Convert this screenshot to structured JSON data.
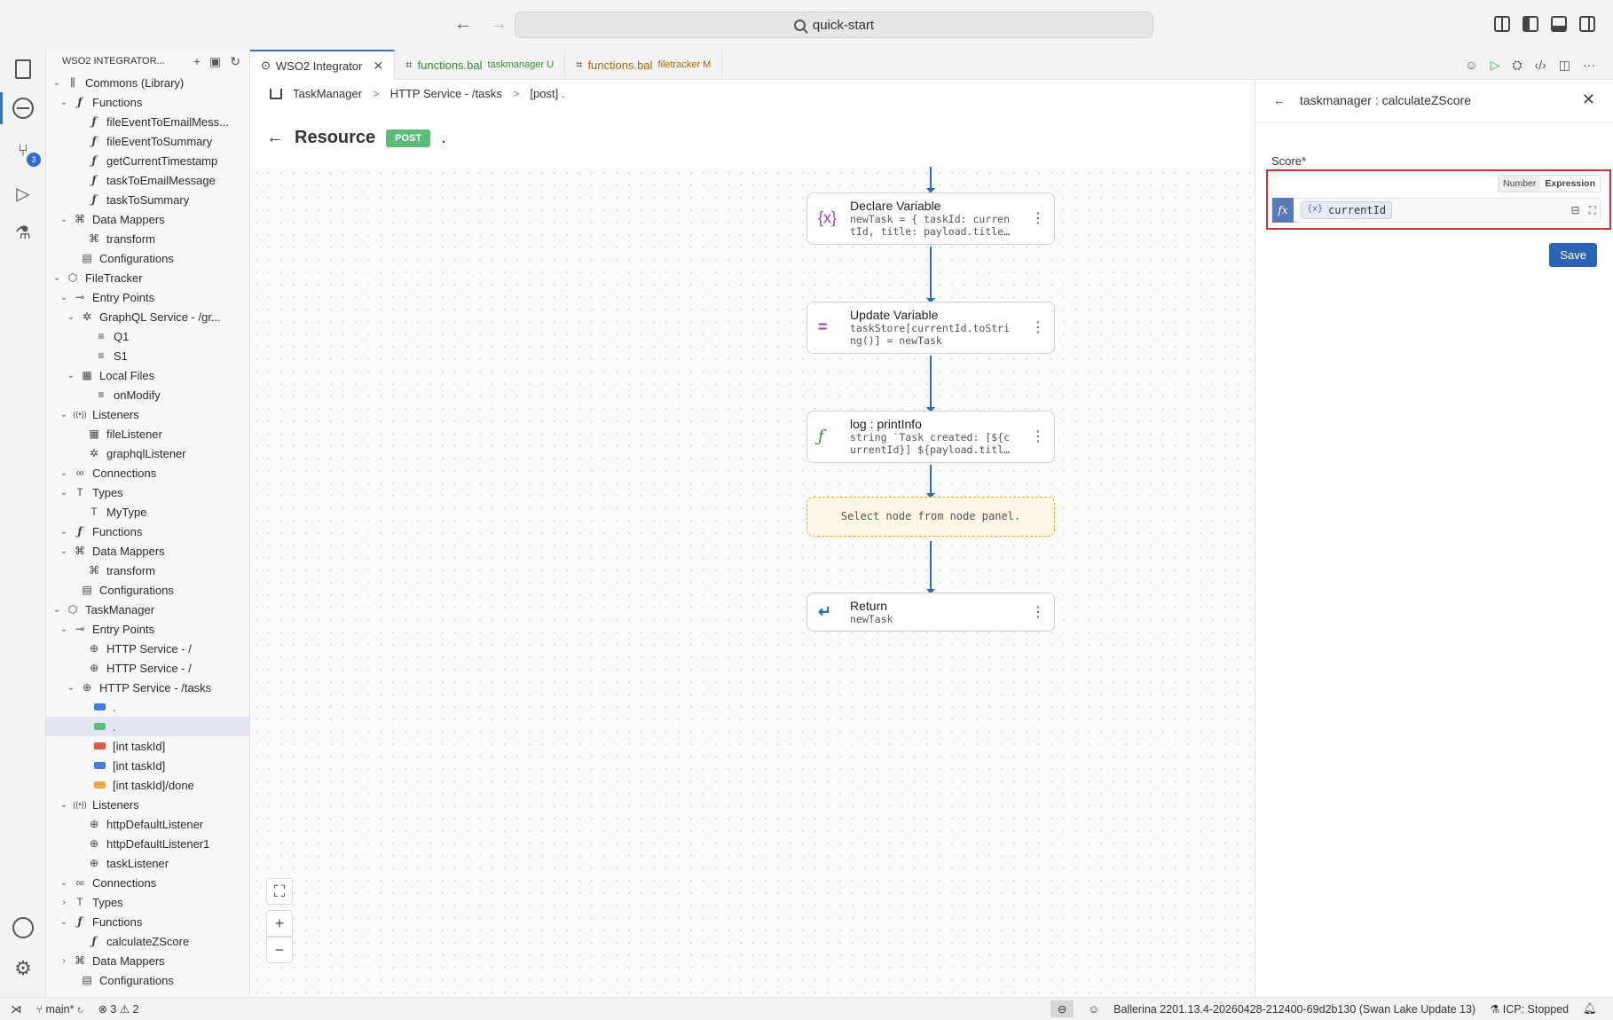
{
  "titlebar": {
    "search": "quick-start"
  },
  "sidebar": {
    "title": "WSO2 INTEGRATOR...",
    "tree": [
      {
        "label": "Commons (Library)",
        "depth": 0,
        "chev": "v",
        "icon": "lib"
      },
      {
        "label": "Functions",
        "depth": 1,
        "chev": "v",
        "icon": "fn"
      },
      {
        "label": "fileEventToEmailMess...",
        "depth": 3,
        "chev": "",
        "icon": "fn"
      },
      {
        "label": "fileEventToSummary",
        "depth": 3,
        "chev": "",
        "icon": "fn"
      },
      {
        "label": "getCurrentTimestamp",
        "depth": 3,
        "chev": "",
        "icon": "fn"
      },
      {
        "label": "taskToEmailMessage",
        "depth": 3,
        "chev": "",
        "icon": "fn"
      },
      {
        "label": "taskToSummary",
        "depth": 3,
        "chev": "",
        "icon": "fn"
      },
      {
        "label": "Data Mappers",
        "depth": 1,
        "chev": "v",
        "icon": "dm"
      },
      {
        "label": "transform",
        "depth": 3,
        "chev": "",
        "icon": "dm"
      },
      {
        "label": "Configurations",
        "depth": 2,
        "chev": "",
        "icon": "cfg"
      },
      {
        "label": "FileTracker",
        "depth": 0,
        "chev": "v",
        "icon": "pkg"
      },
      {
        "label": "Entry Points",
        "depth": 1,
        "chev": "v",
        "icon": "entry"
      },
      {
        "label": "GraphQL Service - /gr...",
        "depth": 2,
        "chev": "v",
        "icon": "gql"
      },
      {
        "label": "Q1",
        "depth": 4,
        "chev": "",
        "icon": "item"
      },
      {
        "label": "S1",
        "depth": 4,
        "chev": "",
        "icon": "item"
      },
      {
        "label": "Local Files",
        "depth": 2,
        "chev": "v",
        "icon": "files"
      },
      {
        "label": "onModify",
        "depth": 4,
        "chev": "",
        "icon": "item"
      },
      {
        "label": "Listeners",
        "depth": 1,
        "chev": "v",
        "icon": "listen"
      },
      {
        "label": "fileListener",
        "depth": 3,
        "chev": "",
        "icon": "files"
      },
      {
        "label": "graphqlListener",
        "depth": 3,
        "chev": "",
        "icon": "gql"
      },
      {
        "label": "Connections",
        "depth": 1,
        "chev": "v",
        "icon": "conn"
      },
      {
        "label": "Types",
        "depth": 1,
        "chev": "v",
        "icon": "type"
      },
      {
        "label": "MyType",
        "depth": 3,
        "chev": "",
        "icon": "type"
      },
      {
        "label": "Functions",
        "depth": 1,
        "chev": "v",
        "icon": "fn"
      },
      {
        "label": "Data Mappers",
        "depth": 1,
        "chev": "v",
        "icon": "dm"
      },
      {
        "label": "transform",
        "depth": 3,
        "chev": "",
        "icon": "dm"
      },
      {
        "label": "Configurations",
        "depth": 2,
        "chev": "",
        "icon": "cfg"
      },
      {
        "label": "TaskManager",
        "depth": 0,
        "chev": "v",
        "icon": "pkg"
      },
      {
        "label": "Entry Points",
        "depth": 1,
        "chev": "v",
        "icon": "entry"
      },
      {
        "label": "HTTP Service - /",
        "depth": 3,
        "chev": "",
        "icon": "globe"
      },
      {
        "label": "HTTP Service - /",
        "depth": 3,
        "chev": "",
        "icon": "globe"
      },
      {
        "label": "HTTP Service - /tasks",
        "depth": 2,
        "chev": "v",
        "icon": "globe"
      },
      {
        "label": ".",
        "depth": 4,
        "chev": "",
        "icon": "m-get"
      },
      {
        "label": ".",
        "depth": 4,
        "chev": "",
        "icon": "m-post",
        "selected": true
      },
      {
        "label": "[int taskId]",
        "depth": 4,
        "chev": "",
        "icon": "m-del"
      },
      {
        "label": "[int taskId]",
        "depth": 4,
        "chev": "",
        "icon": "m-get"
      },
      {
        "label": "[int taskId]/done",
        "depth": 4,
        "chev": "",
        "icon": "m-patch"
      },
      {
        "label": "Listeners",
        "depth": 1,
        "chev": "v",
        "icon": "listen"
      },
      {
        "label": "httpDefaultListener",
        "depth": 3,
        "chev": "",
        "icon": "globe"
      },
      {
        "label": "httpDefaultListener1",
        "depth": 3,
        "chev": "",
        "icon": "globe"
      },
      {
        "label": "taskListener",
        "depth": 3,
        "chev": "",
        "icon": "globe"
      },
      {
        "label": "Connections",
        "depth": 1,
        "chev": "v",
        "icon": "conn"
      },
      {
        "label": "Types",
        "depth": 1,
        "chev": ">",
        "icon": "type"
      },
      {
        "label": "Functions",
        "depth": 1,
        "chev": "v",
        "icon": "fn"
      },
      {
        "label": "calculateZScore",
        "depth": 3,
        "chev": "",
        "icon": "fn"
      },
      {
        "label": "Data Mappers",
        "depth": 1,
        "chev": ">",
        "icon": "dm"
      },
      {
        "label": "Configurations",
        "depth": 2,
        "chev": "",
        "icon": "cfg"
      }
    ]
  },
  "tabs": [
    {
      "label": "WSO2 Integrator",
      "sub": "",
      "active": true
    },
    {
      "label": "functions.bal",
      "sub": "taskmanager U",
      "color": "g"
    },
    {
      "label": "functions.bal",
      "sub": "filetracker M",
      "color": "o"
    }
  ],
  "breadcrumb": [
    "TaskManager",
    "HTTP Service - /tasks",
    "[post] ."
  ],
  "resource": {
    "title": "Resource",
    "method": "POST",
    "path": "."
  },
  "flow": [
    {
      "icon": "{x}",
      "title": "Declare Variable",
      "sub": [
        "newTask = { taskId: curren",
        "tId, title: payload.title…"
      ]
    },
    {
      "icon": "=",
      "title": "Update Variable",
      "sub": [
        "taskStore[currentId.toStri",
        "ng()] = newTask"
      ]
    },
    {
      "icon": "ƒ",
      "title": "log : printInfo",
      "sub": [
        "string `Task created: [${c",
        "urrentId}] ${payload.titl…"
      ]
    },
    {
      "placeholder": "Select node from node panel."
    },
    {
      "icon": "↵",
      "title": "Return",
      "sub": [
        "newTask"
      ]
    }
  ],
  "panel": {
    "title": "taskmanager : calculateZScore",
    "field_label": "Score*",
    "mode_number": "Number",
    "mode_expression": "Expression",
    "chip_icon": "{x}",
    "chip_value": "currentId",
    "save": "Save"
  },
  "status": {
    "branch": "main*",
    "errors": "3",
    "warnings": "2",
    "ballerina": "Ballerina 2201.13.4-20260428-212400-69d2b130 (Swan Lake Update 13)",
    "icp": "ICP: Stopped"
  },
  "colors": {
    "accent": "#2d63b4",
    "post": "#5dbb7d",
    "highlight_box": "#cc3333"
  }
}
